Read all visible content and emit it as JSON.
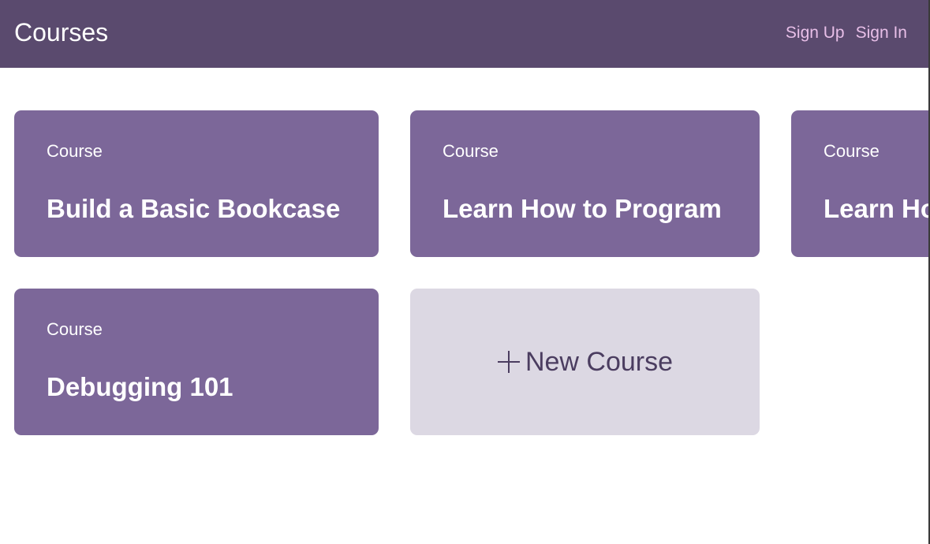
{
  "header": {
    "title": "Courses",
    "links": [
      {
        "label": "Sign Up"
      },
      {
        "label": "Sign In"
      }
    ]
  },
  "courses": [
    {
      "kicker": "Course",
      "title": "Build a Basic Bookcase"
    },
    {
      "kicker": "Course",
      "title": "Learn How to Program"
    },
    {
      "kicker": "Course",
      "title": "Learn How to Program"
    },
    {
      "kicker": "Course",
      "title": "Debugging 101"
    }
  ],
  "new_course": {
    "label": "New Course",
    "icon": "plus-icon"
  },
  "colors": {
    "header_bg": "#5a4a6e",
    "card_bg": "#7c6799",
    "new_card_bg": "#dcd8e3",
    "nav_link": "#e8bfe8",
    "new_card_text": "#4b3d60"
  }
}
